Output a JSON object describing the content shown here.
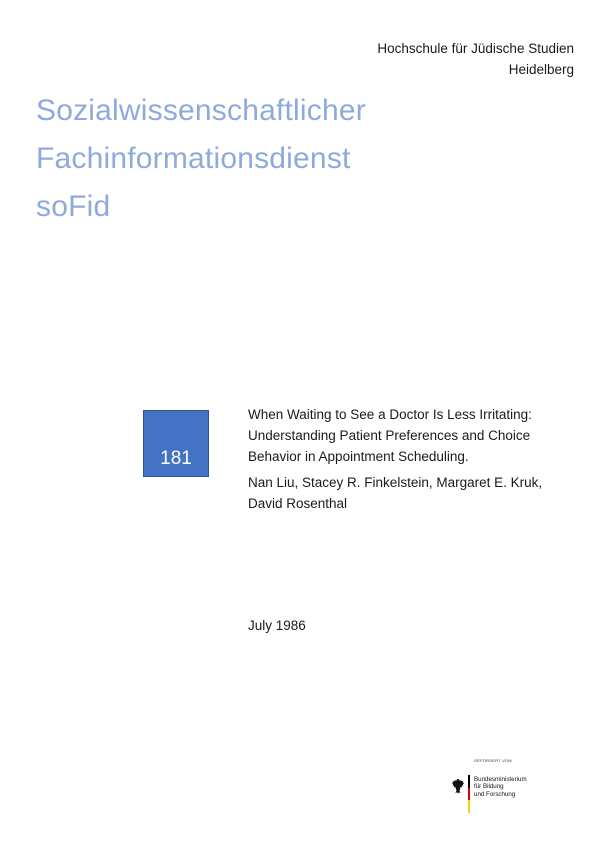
{
  "institution": {
    "line1": "Hochschule für Jüdische Studien",
    "line2": "Heidelberg"
  },
  "title": {
    "line1": "Sozialwissenschaftlicher",
    "line2": "Fachinformationsdienst",
    "line3": "soFid"
  },
  "issue": {
    "number": "181"
  },
  "article": {
    "title_line1": "When Waiting to See a Doctor Is Less Irritating:",
    "title_line2": "Understanding Patient Preferences and Choice",
    "title_line3": "Behavior in Appointment Scheduling.",
    "authors_line1": "Nan Liu, Stacey R. Finkelstein, Margaret E. Kruk,",
    "authors_line2": "David Rosenthal"
  },
  "date": "July 1986",
  "funder": {
    "caption": "GEFÖRDERT VOM",
    "name_line1": "Bundesministerium",
    "name_line2": "für Bildung",
    "name_line3": "und Forschung",
    "flag_colors": [
      "#000000",
      "#dd0000",
      "#ffce00"
    ]
  },
  "colors": {
    "title": "#8eaadb",
    "issue_box": "#4472c4"
  }
}
